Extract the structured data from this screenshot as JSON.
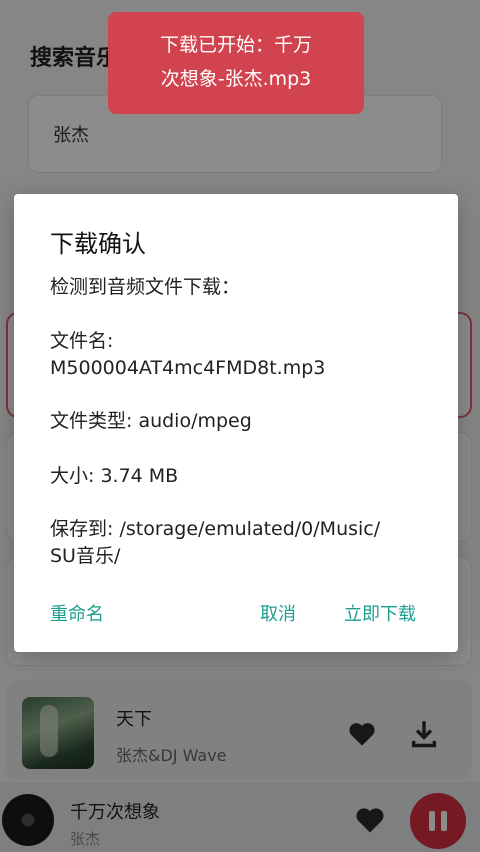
{
  "page": {
    "title": "搜索音乐"
  },
  "search": {
    "value": "张杰"
  },
  "song": {
    "title": "天下",
    "artist": "张杰&DJ Wave"
  },
  "player": {
    "title": "千万次想象",
    "artist": "张杰"
  },
  "dialog": {
    "title": "下载确认",
    "intro": "检测到音频文件下载：",
    "filename_label": "文件名:",
    "filename": "M500004AT4mc4FMD8t.mp3",
    "filetype": "文件类型: audio/mpeg",
    "size": "大小: 3.74 MB",
    "save_to_line1": "保存到: /storage/emulated/0/Music/",
    "save_to_line2": "SU音乐/",
    "rename_label": "重命名",
    "cancel_label": "取消",
    "download_label": "立即下载"
  },
  "toast": {
    "line1": "下载已开始：千万",
    "line2": "次想象-张杰.mp3"
  },
  "colors": {
    "accent": "#d62e3e",
    "button_text": "#1e9e8f",
    "toast_bg": "#d1434e"
  },
  "icons": {
    "favorite": "heart-icon",
    "download": "download-icon",
    "pause": "pause-icon"
  }
}
